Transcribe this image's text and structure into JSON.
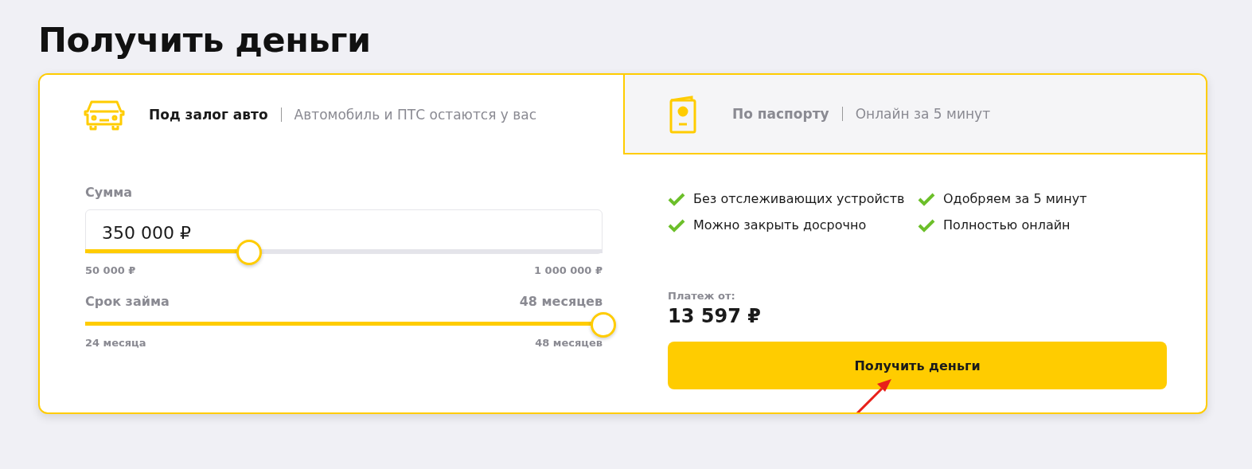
{
  "title": "Получить деньги",
  "tabs": [
    {
      "kind": "car",
      "label": "Под залог авто",
      "note": "Автомобиль и ПТС остаются у вас",
      "selected": true
    },
    {
      "kind": "passport",
      "label": "По паспорту",
      "note": "Онлайн за 5 минут",
      "selected": false
    }
  ],
  "amount": {
    "label": "Сумма",
    "value": "350 000 ₽",
    "level": 0.316,
    "min": "50 000 ₽",
    "max": "1 000 000 ₽"
  },
  "term": {
    "label": "Срок займа",
    "reading": "48 месяцев",
    "level": 1,
    "min": "24 месяца",
    "max": "48 месяцев"
  },
  "features": [
    "Без отслеживающих устройств",
    "Одобряем за 5 минут",
    "Можно закрыть досрочно",
    "Полностью онлайн"
  ],
  "payment": {
    "label": "Платеж от:",
    "value": "13 597 ₽"
  },
  "button": "Получить деньги"
}
